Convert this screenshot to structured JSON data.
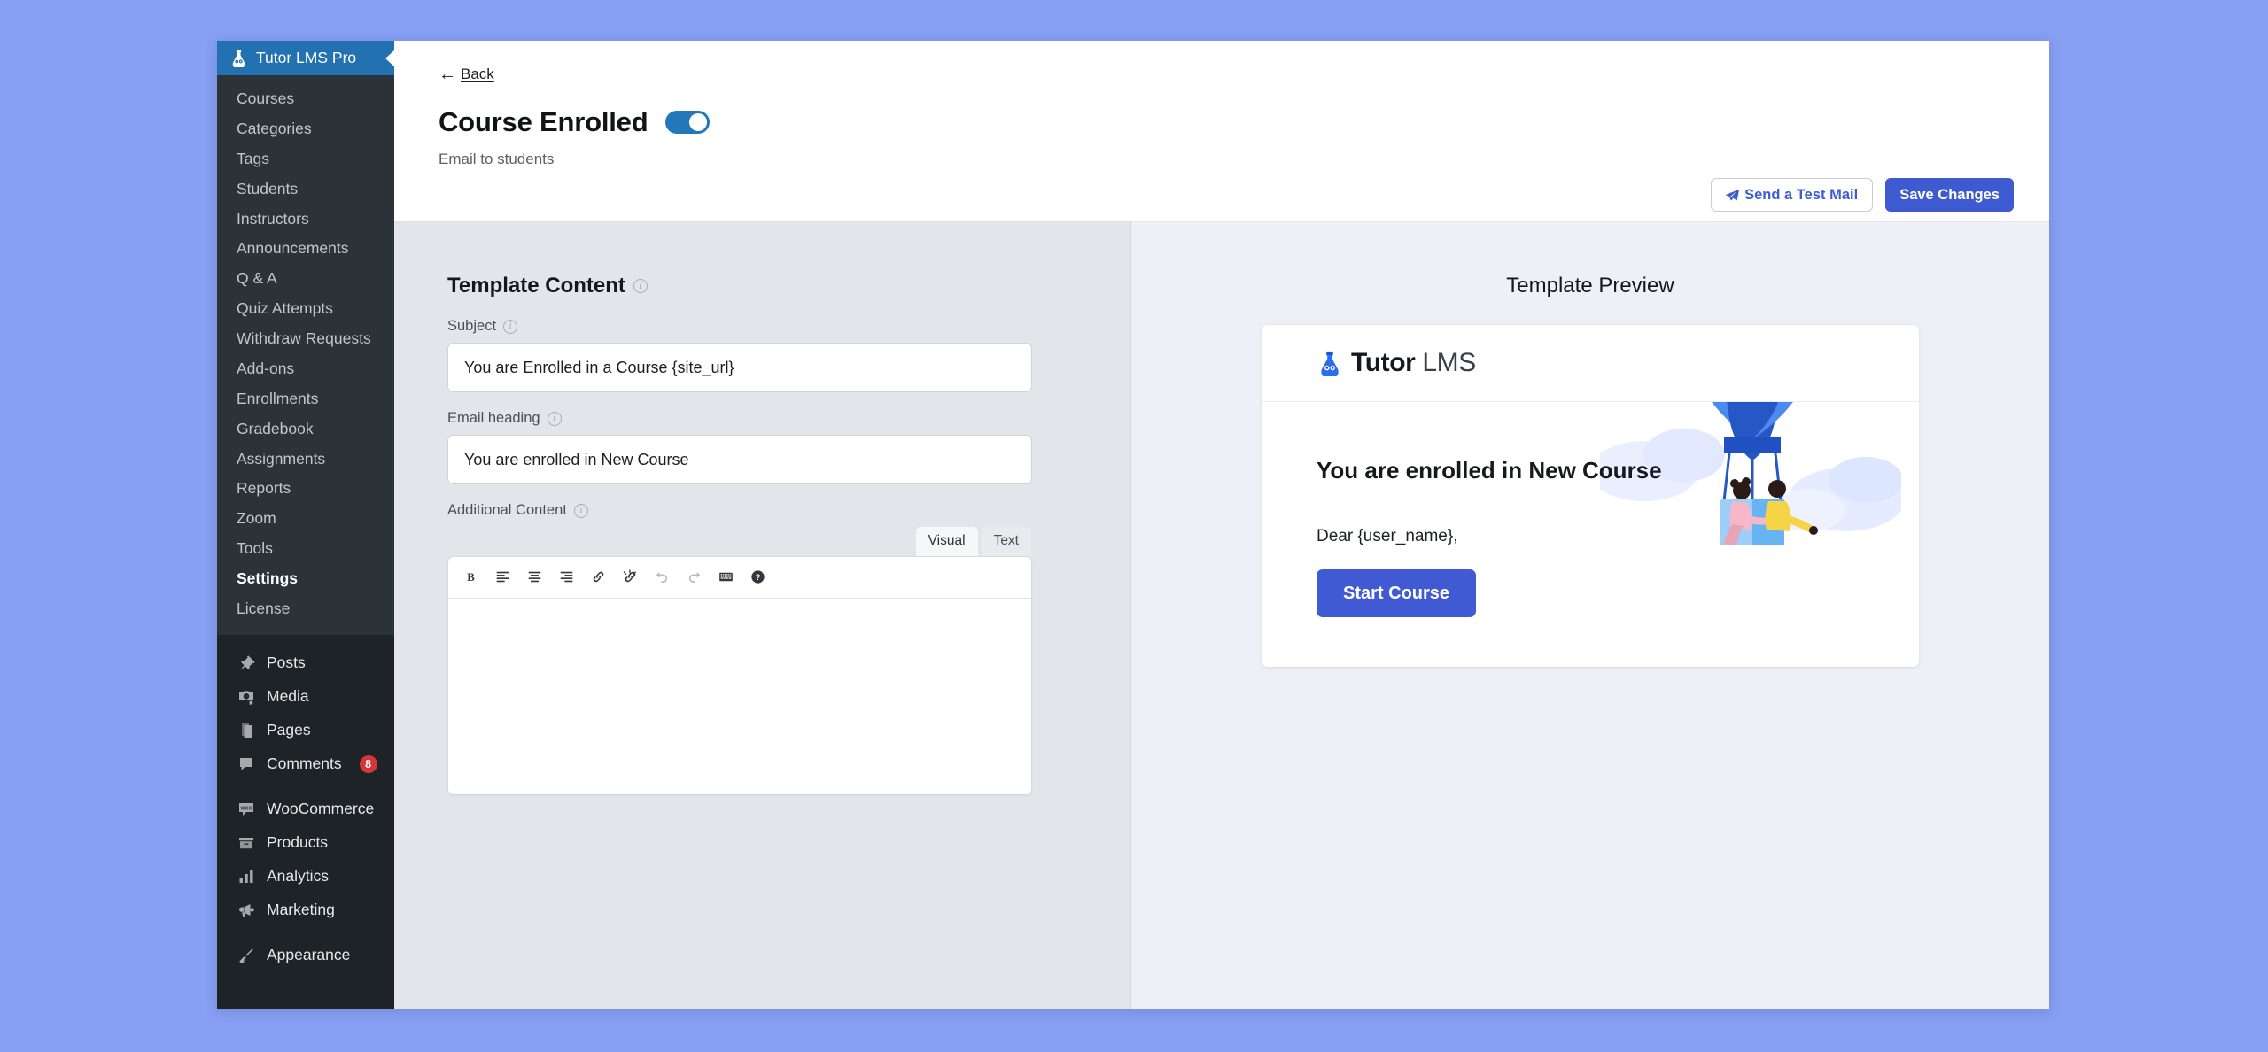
{
  "sidebar": {
    "brand": {
      "label": "Tutor LMS Pro",
      "icon": "tutor-lms-logo-icon"
    },
    "submenu": [
      {
        "label": "Courses",
        "active": false
      },
      {
        "label": "Categories",
        "active": false
      },
      {
        "label": "Tags",
        "active": false
      },
      {
        "label": "Students",
        "active": false
      },
      {
        "label": "Instructors",
        "active": false
      },
      {
        "label": "Announcements",
        "active": false
      },
      {
        "label": "Q & A",
        "active": false
      },
      {
        "label": "Quiz Attempts",
        "active": false
      },
      {
        "label": "Withdraw Requests",
        "active": false
      },
      {
        "label": "Add-ons",
        "active": false
      },
      {
        "label": "Enrollments",
        "active": false
      },
      {
        "label": "Gradebook",
        "active": false
      },
      {
        "label": "Assignments",
        "active": false
      },
      {
        "label": "Reports",
        "active": false
      },
      {
        "label": "Zoom",
        "active": false
      },
      {
        "label": "Tools",
        "active": false
      },
      {
        "label": "Settings",
        "active": true
      },
      {
        "label": "License",
        "active": false
      }
    ],
    "wp_menu_group_1": [
      {
        "label": "Posts",
        "icon": "pin-icon"
      },
      {
        "label": "Media",
        "icon": "camera-icon"
      },
      {
        "label": "Pages",
        "icon": "pages-icon"
      },
      {
        "label": "Comments",
        "icon": "comment-icon",
        "badge": "8"
      }
    ],
    "wp_menu_group_2": [
      {
        "label": "WooCommerce",
        "icon": "woo-icon"
      },
      {
        "label": "Products",
        "icon": "products-icon"
      },
      {
        "label": "Analytics",
        "icon": "bar-chart-icon"
      },
      {
        "label": "Marketing",
        "icon": "megaphone-icon"
      }
    ],
    "wp_menu_group_3": [
      {
        "label": "Appearance",
        "icon": "brush-icon"
      }
    ]
  },
  "header": {
    "back_label": "Back",
    "title": "Course Enrolled",
    "subtitle": "Email to students",
    "toggle_enabled": true,
    "send_test_label": "Send a Test Mail",
    "save_label": "Save Changes"
  },
  "template_content": {
    "section_title": "Template Content",
    "subject": {
      "label": "Subject",
      "value": "You are Enrolled in a Course {site_url}",
      "placeholder": "Subject"
    },
    "email_heading": {
      "label": "Email heading",
      "value": "You are enrolled in New Course",
      "placeholder": "Email heading"
    },
    "additional_content": {
      "label": "Additional Content",
      "value": "",
      "placeholder": ""
    },
    "editor_tabs": [
      {
        "label": "Visual",
        "active": true
      },
      {
        "label": "Text",
        "active": false
      }
    ],
    "toolbar": [
      {
        "name": "bold-icon",
        "title": "Bold"
      },
      {
        "name": "align-left-icon",
        "title": "Align left"
      },
      {
        "name": "align-center-icon",
        "title": "Align center"
      },
      {
        "name": "align-right-icon",
        "title": "Align right"
      },
      {
        "name": "link-icon",
        "title": "Insert link"
      },
      {
        "name": "unlink-icon",
        "title": "Remove link"
      },
      {
        "name": "undo-icon",
        "title": "Undo"
      },
      {
        "name": "redo-icon",
        "title": "Redo"
      },
      {
        "name": "keyboard-icon",
        "title": "Keyboard shortcuts"
      },
      {
        "name": "help-icon",
        "title": "Help"
      }
    ]
  },
  "preview": {
    "title": "Template Preview",
    "logo_bold": "Tutor",
    "logo_light": "LMS",
    "heading": "You are enrolled in New Course",
    "greeting": "Dear {user_name},",
    "cta_label": "Start Course"
  },
  "colors": {
    "page_background": "#88a0f4",
    "brand_blue": "#2271b1",
    "accent_indigo": "#3e5ad0",
    "toggle_on": "#2477b8",
    "badge_red": "#d63638",
    "sidebar_dark": "#1d2327",
    "submenu_dark": "#2c3338"
  }
}
